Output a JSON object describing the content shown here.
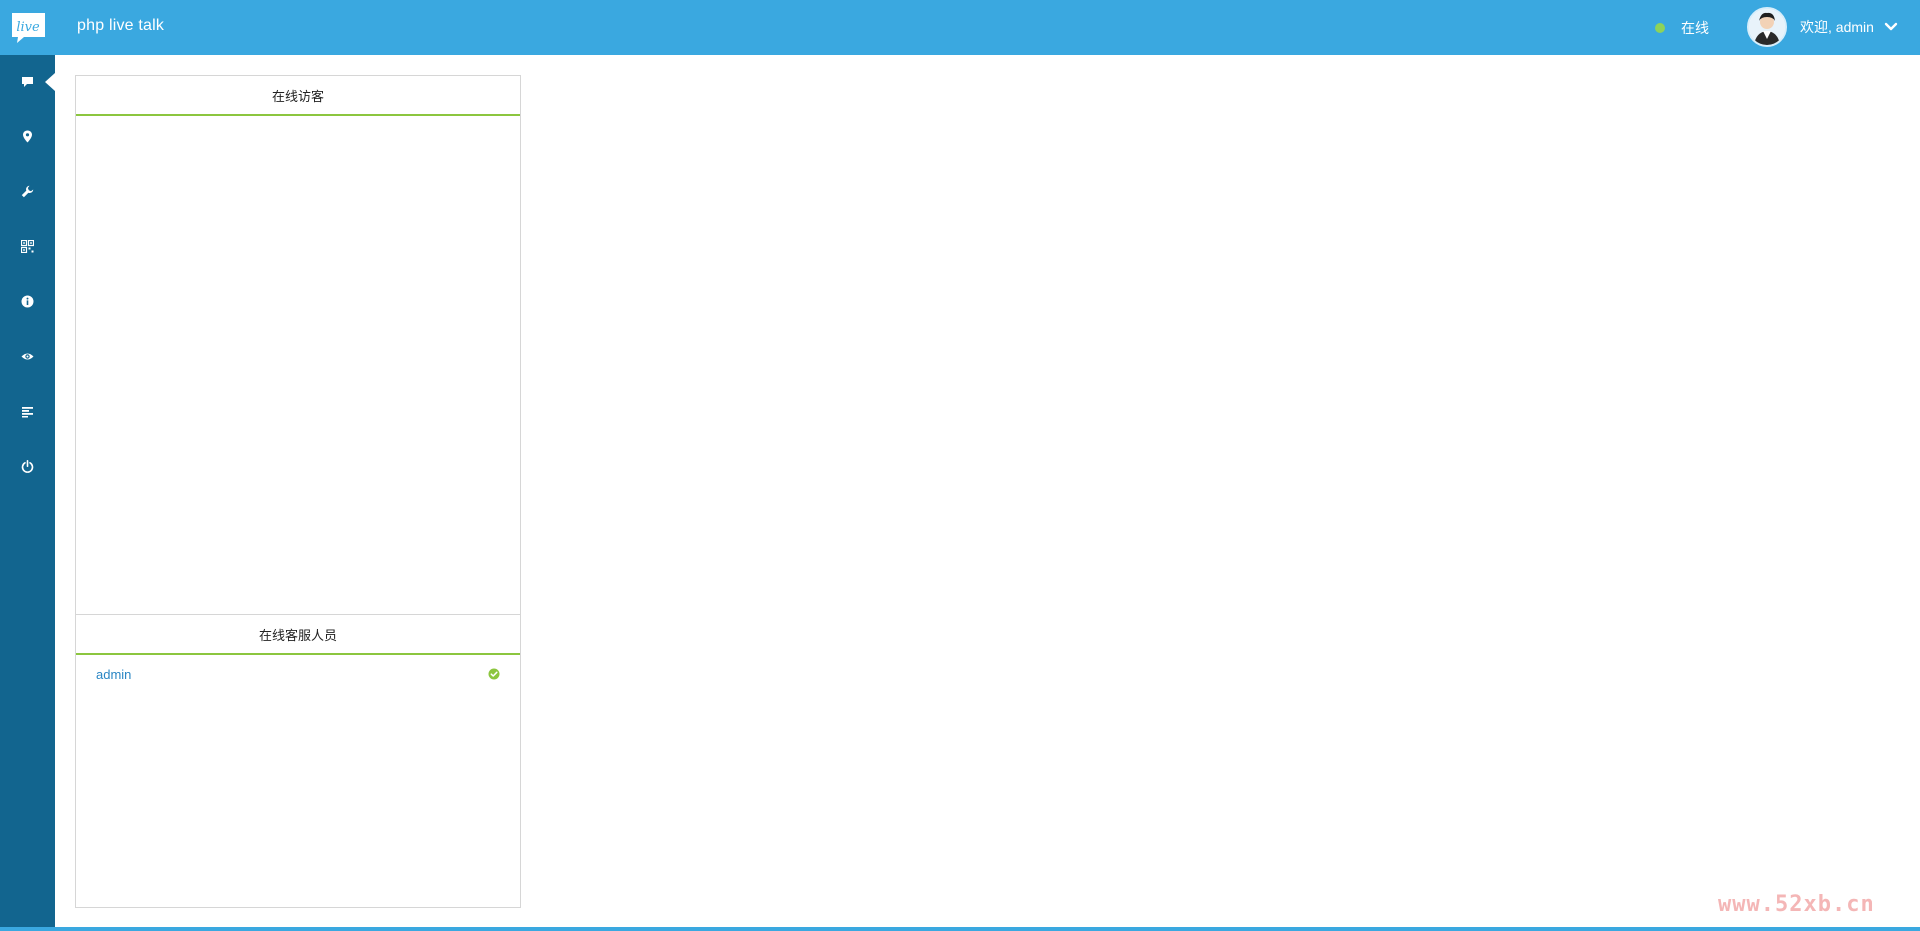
{
  "header": {
    "logo_text": "live",
    "app_title": "php live talk",
    "status_label": "在线",
    "welcome_label": "欢迎, admin",
    "colors": {
      "bar": "#3aa8e0",
      "status_dot": "#8dd35a"
    }
  },
  "sidebar": {
    "background": "#12658f",
    "items": [
      {
        "icon": "chat-icon",
        "active": true
      },
      {
        "icon": "map-pin-icon"
      },
      {
        "icon": "wrench-icon"
      },
      {
        "icon": "qr-code-icon"
      },
      {
        "icon": "info-icon"
      },
      {
        "icon": "eye-icon"
      },
      {
        "icon": "list-icon"
      },
      {
        "icon": "power-icon"
      }
    ]
  },
  "panel": {
    "visitors_title": "在线访客",
    "agents_title": "在线客服人员",
    "agents": [
      {
        "name": "admin",
        "online": true
      }
    ],
    "accent": "#8cc63f"
  },
  "watermark": {
    "text": "www.52xb.cn"
  }
}
